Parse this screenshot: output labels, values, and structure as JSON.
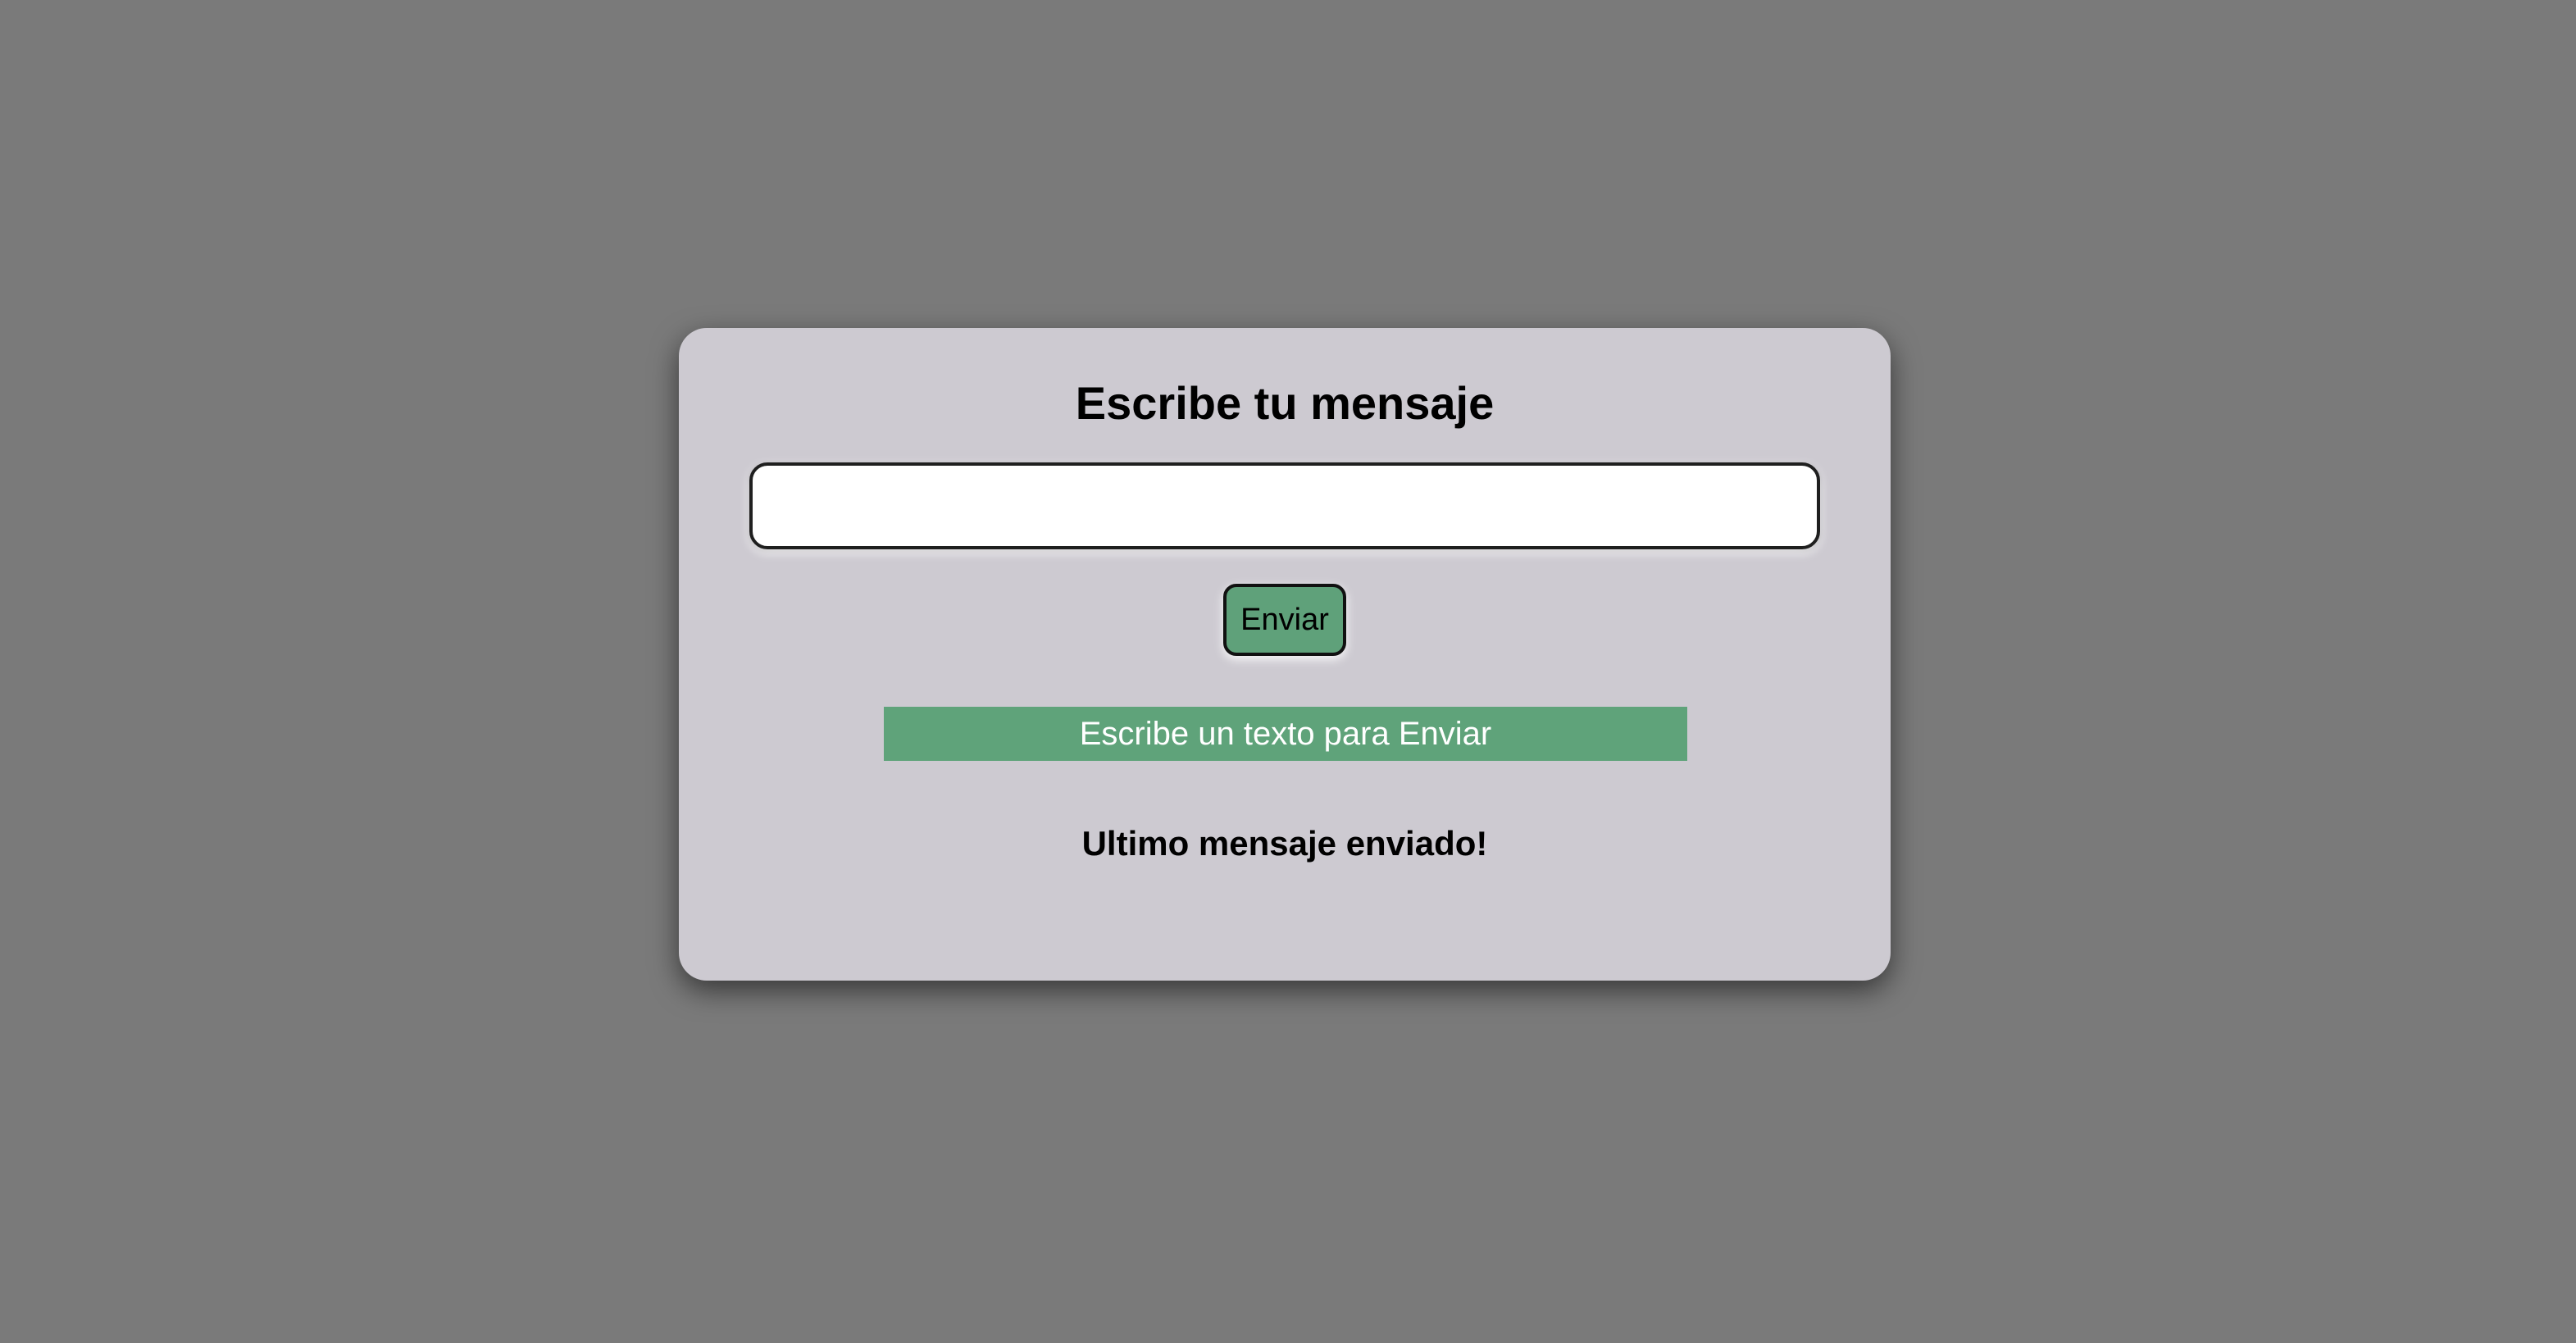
{
  "form": {
    "title": "Escribe tu mensaje",
    "input_value": "",
    "send_label": "Enviar",
    "status_text": "Escribe un texto para Enviar",
    "last_message_label": "Ultimo mensaje enviado!"
  },
  "colors": {
    "background": "#7a7a7a",
    "card": "#cdcad1",
    "accent_green": "#5fa37a",
    "status_text": "#ffffff"
  }
}
